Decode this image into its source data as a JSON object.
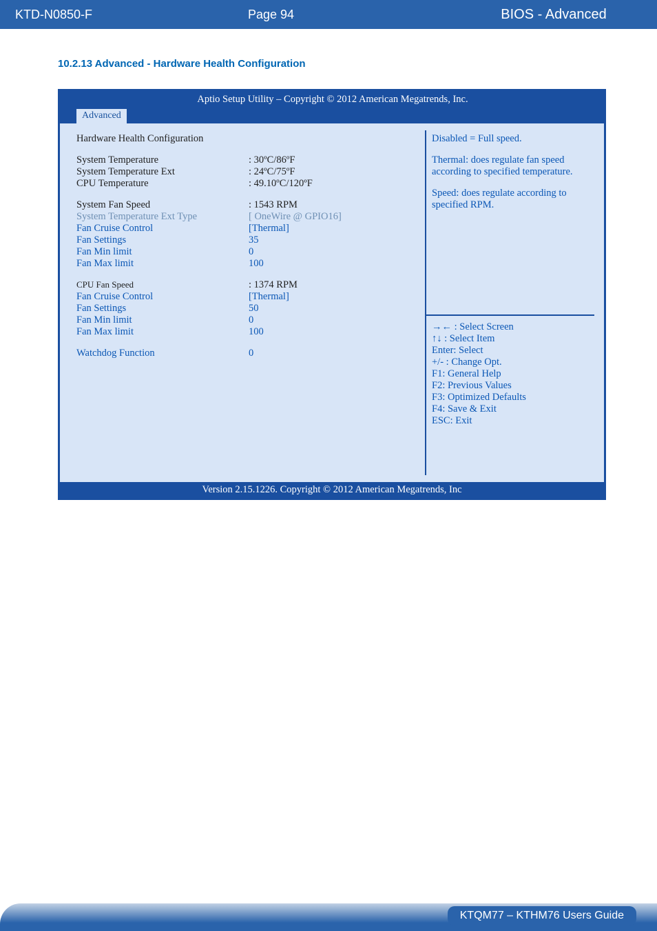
{
  "header": {
    "doc_code": "KTD-N0850-F",
    "page_label": "Page 94",
    "section": "BIOS - Advanced"
  },
  "section_heading": "10.2.13  Advanced  -  Hardware Health Configuration",
  "bios": {
    "title": "Aptio Setup Utility  –  Copyright © 2012 American Megatrends, Inc.",
    "tab": "Advanced",
    "heading": "Hardware Health Configuration",
    "rows": {
      "sys_temp_label": "System Temperature",
      "sys_temp_val": ":   30ºC/86ºF",
      "sys_temp_ext_label": "System Temperature Ext",
      "sys_temp_ext_val": ":   24ºC/75ºF",
      "cpu_temp_label": "CPU Temperature",
      "cpu_temp_val": ":   49.10ºC/120ºF",
      "sys_fan_label": "System Fan Speed",
      "sys_fan_val": ":  1543 RPM",
      "sys_temp_ext_type_label": "System Temperature Ext Type",
      "sys_temp_ext_type_val": "[ OneWire @ GPIO16]",
      "fan_cruise1_label": "Fan Cruise Control",
      "fan_cruise1_val": "[Thermal]",
      "fan_settings1_label": "Fan Settings",
      "fan_settings1_val": "35",
      "fan_min1_label": "Fan Min limit",
      "fan_min1_val": "0",
      "fan_max1_label": "Fan Max limit",
      "fan_max1_val": "100",
      "cpu_fan_speed_label": "CPU Fan Speed",
      "cpu_fan_speed_val": ": 1374 RPM",
      "fan_cruise2_label": "Fan Cruise Control",
      "fan_cruise2_val": "[Thermal]",
      "fan_settings2_label": "Fan Settings",
      "fan_settings2_val": "50",
      "fan_min2_label": "Fan Min limit",
      "fan_min2_val": "0",
      "fan_max2_label": "Fan Max limit",
      "fan_max2_val": "100",
      "watchdog_label": "Watchdog Function",
      "watchdog_val": "0"
    },
    "help": {
      "line1": "Disabled = Full speed.",
      "line2": "Thermal: does regulate fan speed according to specified temperature.",
      "line3": "Speed: does regulate according to specified RPM."
    },
    "keys": {
      "k1": "→← : Select Screen",
      "k2": "↑↓ : Select Item",
      "k3": "Enter: Select",
      "k4": "+/- : Change Opt.",
      "k5": "F1: General Help",
      "k6": "F2: Previous Values",
      "k7": "F3: Optimized Defaults",
      "k8": "F4: Save & Exit",
      "k9": "ESC: Exit"
    },
    "footer": "Version 2.15.1226. Copyright © 2012 American Megatrends, Inc"
  },
  "footer_guide": "KTQM77 – KTHM76 Users Guide"
}
